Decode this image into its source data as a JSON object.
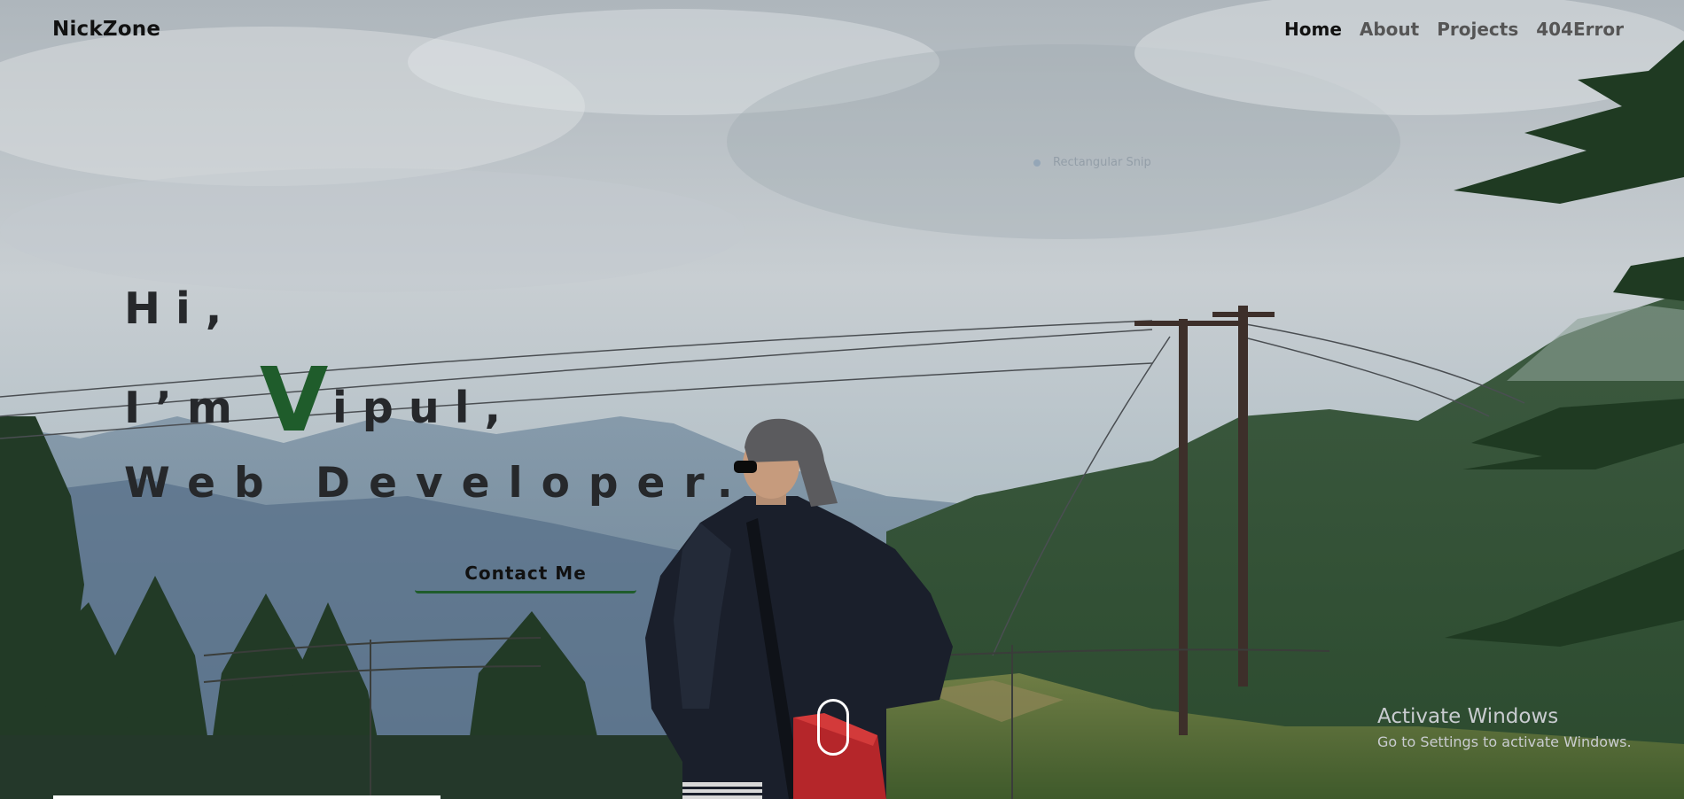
{
  "header": {
    "brand": "NickZone",
    "nav": [
      {
        "label": "Home",
        "active": true
      },
      {
        "label": "About",
        "active": false
      },
      {
        "label": "Projects",
        "active": false
      },
      {
        "label": "404Error",
        "active": false
      }
    ]
  },
  "overlay_hint": "Rectangular Snip",
  "hero": {
    "line1": "Hi,",
    "line2_prefix": "I’m",
    "line2_initial": "V",
    "line2_rest": "ipul,",
    "line3": "Web Developer.",
    "contact_button": "Contact Me"
  },
  "watermark": {
    "title": "Activate Windows",
    "subtitle": "Go to Settings to activate Windows."
  },
  "colors": {
    "accent": "#1f5c2b",
    "text_dark": "#26282b",
    "nav_inactive": "#555555"
  },
  "progress": 0.23
}
